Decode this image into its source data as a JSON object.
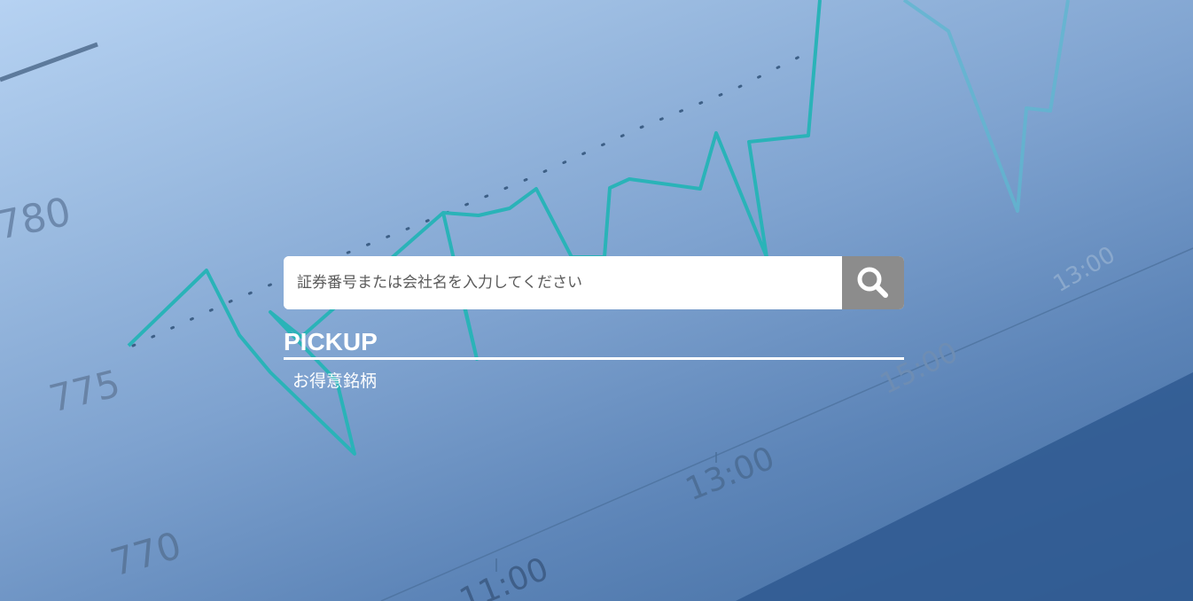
{
  "search": {
    "placeholder": "証券番号または会社名を入力してください",
    "value": "",
    "button_icon": "search-icon"
  },
  "pickup": {
    "heading": "PICKUP",
    "links": [
      {
        "label": "お得意銘柄"
      }
    ]
  },
  "background": {
    "tick_labels": [
      "780",
      "775",
      "770",
      "13:00",
      "11:00",
      "13:00",
      "15:00"
    ],
    "line_color": "#2ab3b8",
    "overlay_color": "#5d85b8"
  }
}
